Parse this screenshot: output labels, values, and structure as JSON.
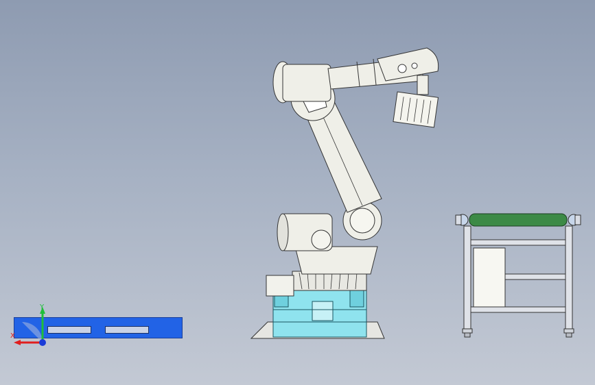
{
  "view": {
    "background_top": "#8e9bb1",
    "background_bottom": "#c3c9d4"
  },
  "triad": {
    "x_label": "X",
    "y_label": "Y",
    "x_color": "#e01e1e",
    "y_color": "#1fbf3a",
    "z_color": "#1a3bd8"
  },
  "model": {
    "robot_color": "#efefe8",
    "base_cyan": "#8fe3ee",
    "conveyor_belt_color": "#3c8a46",
    "origin_plate_color": "#2263e6"
  }
}
